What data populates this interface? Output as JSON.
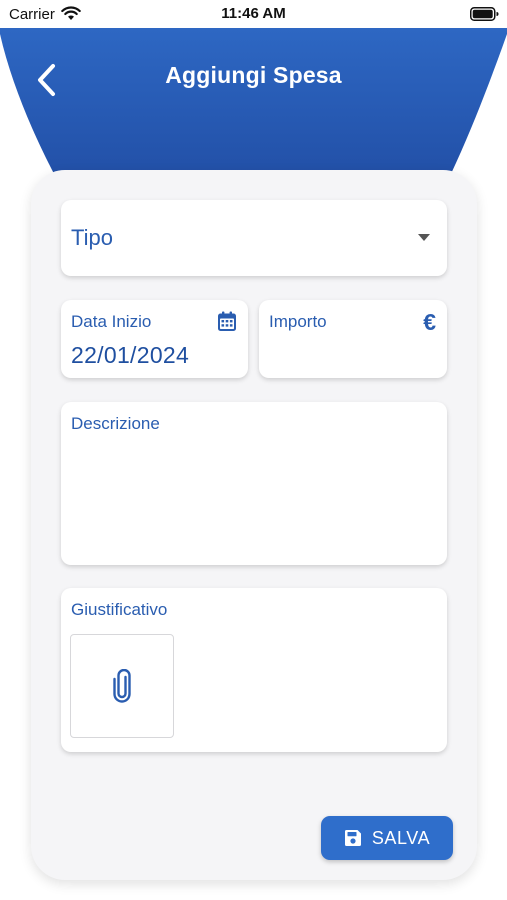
{
  "status_bar": {
    "carrier": "Carrier",
    "time": "11:46 AM"
  },
  "header": {
    "title": "Aggiungi Spesa",
    "back_icon": "chevron-left-icon",
    "gradient_top": "#2e68c4",
    "gradient_bottom": "#1f4aa0"
  },
  "form": {
    "tipo": {
      "label": "Tipo",
      "icon": "dropdown-arrow-icon"
    },
    "data_inizio": {
      "label": "Data Inizio",
      "value": "22/01/2024",
      "icon": "calendar-icon"
    },
    "importo": {
      "label": "Importo",
      "icon": "euro-icon",
      "symbol": "€"
    },
    "descrizione": {
      "label": "Descrizione"
    },
    "giustificativo": {
      "label": "Giustificativo",
      "icon": "paperclip-icon"
    }
  },
  "actions": {
    "save_label": "SALVA",
    "save_icon": "floppy-disk-icon",
    "accent": "#2f6ecb"
  },
  "colors": {
    "text_accent": "#2a5db0",
    "card_background": "#f5f5f7"
  }
}
